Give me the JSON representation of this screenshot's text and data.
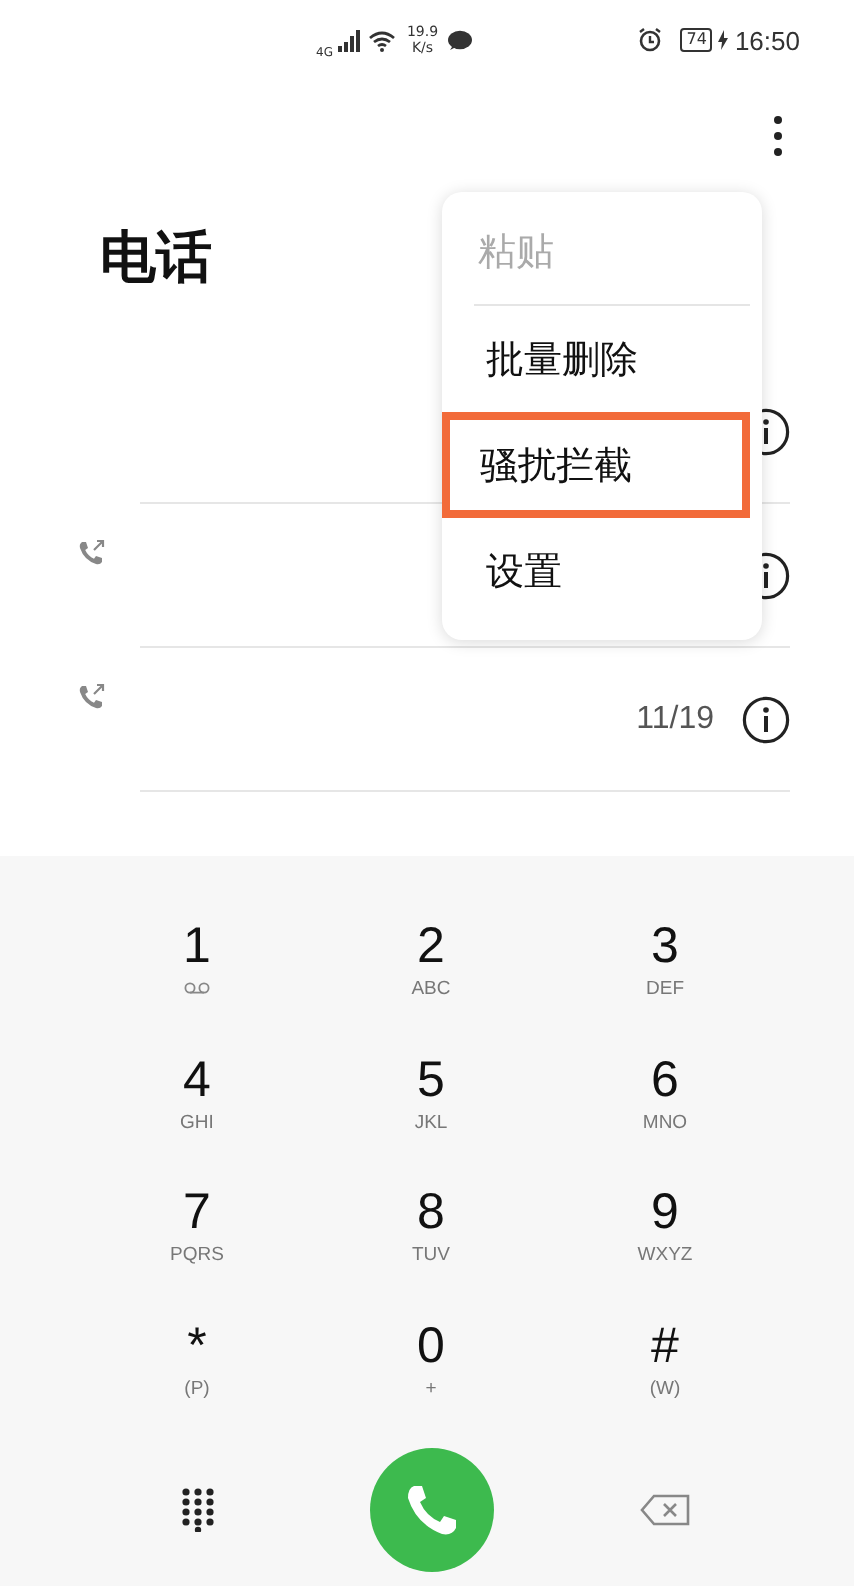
{
  "status_bar": {
    "network": "4G",
    "speed_value": "19.9",
    "speed_unit": "K/s",
    "battery": "74",
    "charging": true,
    "time": "16:50"
  },
  "title": "电话",
  "calls": [
    {
      "outgoing": false
    },
    {
      "outgoing": true
    },
    {
      "outgoing": true,
      "date": "11/19"
    }
  ],
  "menu": {
    "items": [
      {
        "label": "粘贴",
        "disabled": true,
        "highlighted": false
      },
      {
        "label": "批量删除",
        "disabled": false,
        "highlighted": false
      },
      {
        "label": "骚扰拦截",
        "disabled": false,
        "highlighted": true
      },
      {
        "label": "设置",
        "disabled": false,
        "highlighted": false
      }
    ]
  },
  "keypad": {
    "keys": [
      {
        "digit": "1",
        "kind": "voicemail"
      },
      {
        "digit": "2",
        "kind": "letters",
        "sub": "ABC"
      },
      {
        "digit": "3",
        "kind": "letters",
        "sub": "DEF"
      },
      {
        "digit": "4",
        "kind": "letters",
        "sub": "GHI"
      },
      {
        "digit": "5",
        "kind": "letters",
        "sub": "JKL"
      },
      {
        "digit": "6",
        "kind": "letters",
        "sub": "MNO"
      },
      {
        "digit": "7",
        "kind": "letters",
        "sub": "PQRS"
      },
      {
        "digit": "8",
        "kind": "letters",
        "sub": "TUV"
      },
      {
        "digit": "9",
        "kind": "letters",
        "sub": "WXYZ"
      },
      {
        "digit": "*",
        "kind": "letters",
        "sub": "(P)"
      },
      {
        "digit": "0",
        "kind": "letters",
        "sub": "+"
      },
      {
        "digit": "#",
        "kind": "letters",
        "sub": "(W)"
      }
    ]
  }
}
